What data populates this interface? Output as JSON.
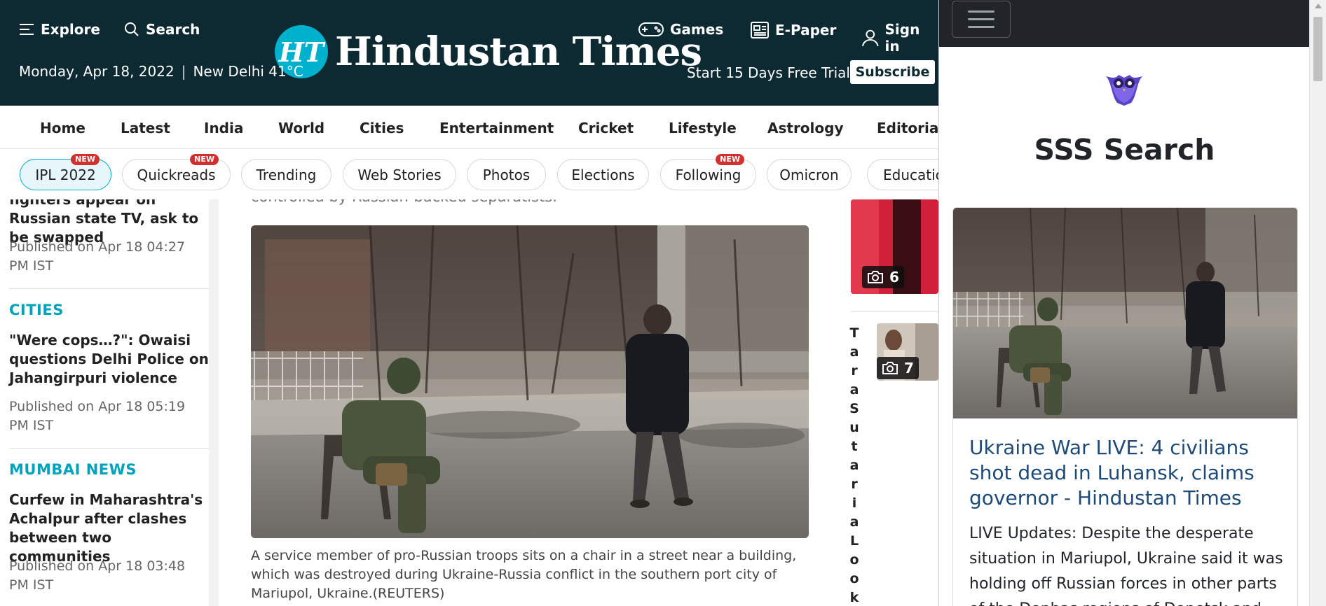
{
  "header": {
    "explore": "Explore",
    "search": "Search",
    "games": "Games",
    "epaper": "E-Paper",
    "signin": "Sign in",
    "date": "Monday, Apr 18, 2022",
    "city_temp": "New Delhi 41°C",
    "logo_mark": "HT",
    "logo_text": "Hindustan Times",
    "trial": "Start 15 Days Free Trial",
    "subscribe": "Subscribe"
  },
  "nav": [
    "Home",
    "Latest",
    "India",
    "World",
    "Cities",
    "Entertainment",
    "Cricket",
    "Lifestyle",
    "Astrology",
    "Editorials"
  ],
  "chips": [
    {
      "label": "IPL 2022",
      "badge": "NEW",
      "active": true
    },
    {
      "label": "Quickreads",
      "badge": "NEW"
    },
    {
      "label": "Trending"
    },
    {
      "label": "Web Stories"
    },
    {
      "label": "Photos"
    },
    {
      "label": "Elections"
    },
    {
      "label": "Following",
      "badge": "NEW"
    },
    {
      "label": "Omicron"
    },
    {
      "label": "Educatio"
    }
  ],
  "left": {
    "story1_title": "fighters appear on Russian state TV, ask to be swapped",
    "story1_time": "Published on Apr 18 04:27 PM IST",
    "cities_head": "CITIES",
    "story2_title": "\"Were cops…?\": Owaisi questions Delhi Police on Jahangirpuri violence",
    "story2_time": "Published on Apr 18 05:19 PM IST",
    "mumbai_head": "MUMBAI NEWS",
    "story3_title": "Curfew in Maharashtra's Achalpur after clashes between two communities",
    "story3_time": "Published on Apr 18 03:48 PM IST"
  },
  "center": {
    "partial_text": "controlled by Russian-backed separatists.",
    "caption": "A service member of pro-Russian troops sits on a chair in a street near a building, which was destroyed during Ukraine-Russia conflict in the southern port city of Mariupol, Ukraine.(REUTERS)"
  },
  "right": {
    "gallery1_count": "6",
    "gallery2_count": "7",
    "vertical_title": "TaraSutariaLook"
  },
  "extension": {
    "title": "SSS Search",
    "card_title": "Ukraine War LIVE: 4 civilians shot dead in Luhansk, claims governor - Hindustan Times",
    "card_text": "LIVE Updates: Despite the desperate situation in Mariupol, Ukraine said it was holding off Russian forces in other parts of the Donbas regions of Donetsk and"
  },
  "colors": {
    "header_bg": "#0d2a33",
    "accent": "#00b1cd",
    "badge_red": "#d32f2f",
    "section_head": "#00a3bd",
    "link_blue": "#1d4a78"
  }
}
